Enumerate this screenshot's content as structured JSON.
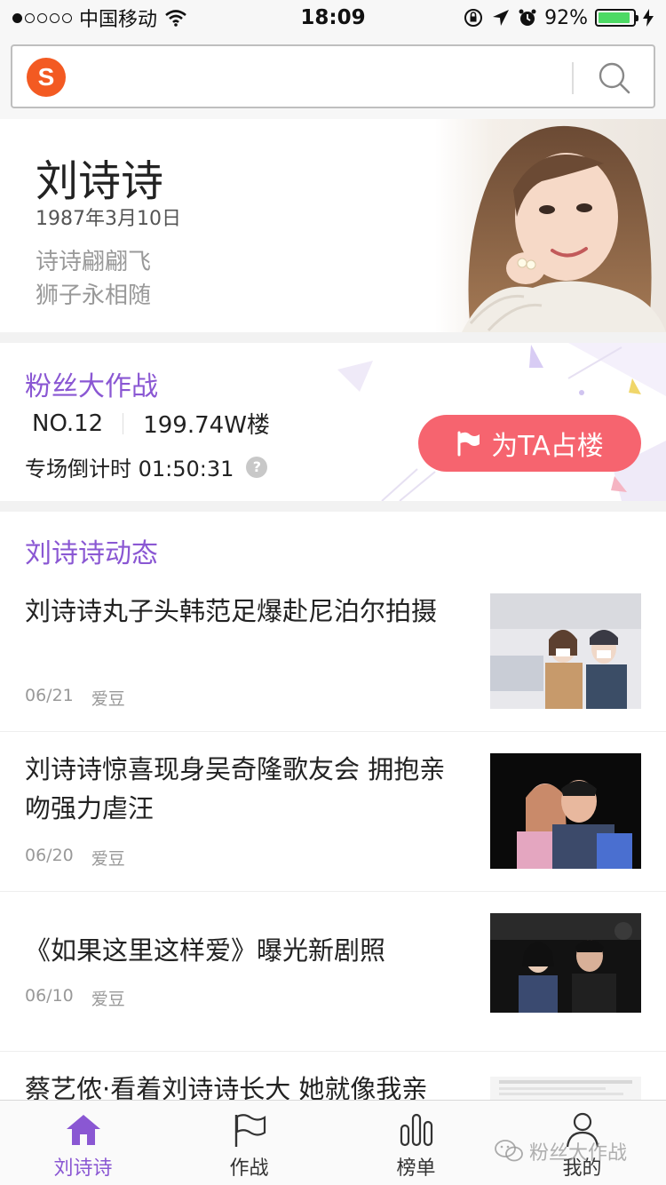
{
  "status_bar": {
    "carrier": "中国移动",
    "time": "18:09",
    "battery": "92%",
    "battery_level": 0.92,
    "signal_bars": 1,
    "signal_total": 5
  },
  "search": {
    "placeholder": "",
    "logo_letter": "S"
  },
  "profile": {
    "name": "刘诗诗",
    "birth": "1987年3月10日",
    "slogan_lines": [
      "诗诗翩翩飞",
      "狮子永相随"
    ]
  },
  "battle": {
    "title": "粉丝大作战",
    "rank": "NO.12",
    "floors": "199.74W楼",
    "countdown_label": "专场倒计时",
    "countdown_value": "01:50:31",
    "help": "?",
    "button_label": "为TA占楼"
  },
  "news": {
    "title": "刘诗诗动态",
    "items": [
      {
        "headline": "刘诗诗丸子头韩范足爆赴尼泊尔拍摄",
        "date": "06/21",
        "source": "爱豆"
      },
      {
        "headline": "刘诗诗惊喜现身吴奇隆歌友会 拥抱亲吻强力虐汪",
        "date": "06/20",
        "source": "爱豆"
      },
      {
        "headline": "《如果这里这样爱》曝光新剧照",
        "date": "06/10",
        "source": "爱豆"
      },
      {
        "headline": "蔡艺侬·看着刘诗诗长大 她就像我亲",
        "date": "",
        "source": ""
      }
    ]
  },
  "tabbar": {
    "tabs": [
      {
        "label": "刘诗诗",
        "icon": "home-icon",
        "active": true
      },
      {
        "label": "作战",
        "icon": "flag-icon",
        "active": false
      },
      {
        "label": "榜单",
        "icon": "chart-bars-icon",
        "active": false
      },
      {
        "label": "我的",
        "icon": "person-icon",
        "active": false
      }
    ]
  },
  "watermark": "粉丝大作战",
  "colors": {
    "accent_purple": "#8a57d3",
    "button_red": "#f6646f",
    "logo_orange": "#f35a22",
    "battery_green": "#4cd964"
  }
}
